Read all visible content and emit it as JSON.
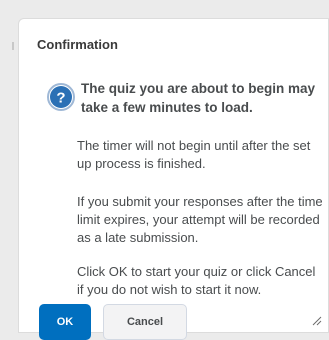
{
  "dialog": {
    "title": "Confirmation",
    "icon": "question-circle-icon",
    "headline": "The quiz you are about to begin may take a few minutes to load.",
    "paragraphs": [
      "The timer will not begin until after the set up process is finished.",
      "If you submit your responses after the time limit expires, your attempt will be recorded as a late submission.",
      "Click OK to start your quiz or click Cancel if you do not wish to start it now."
    ],
    "buttons": {
      "ok_label": "OK",
      "cancel_label": "Cancel"
    }
  },
  "colors": {
    "primary": "#006fbf",
    "icon_blue": "#2b70b5",
    "text": "#494c4e"
  }
}
